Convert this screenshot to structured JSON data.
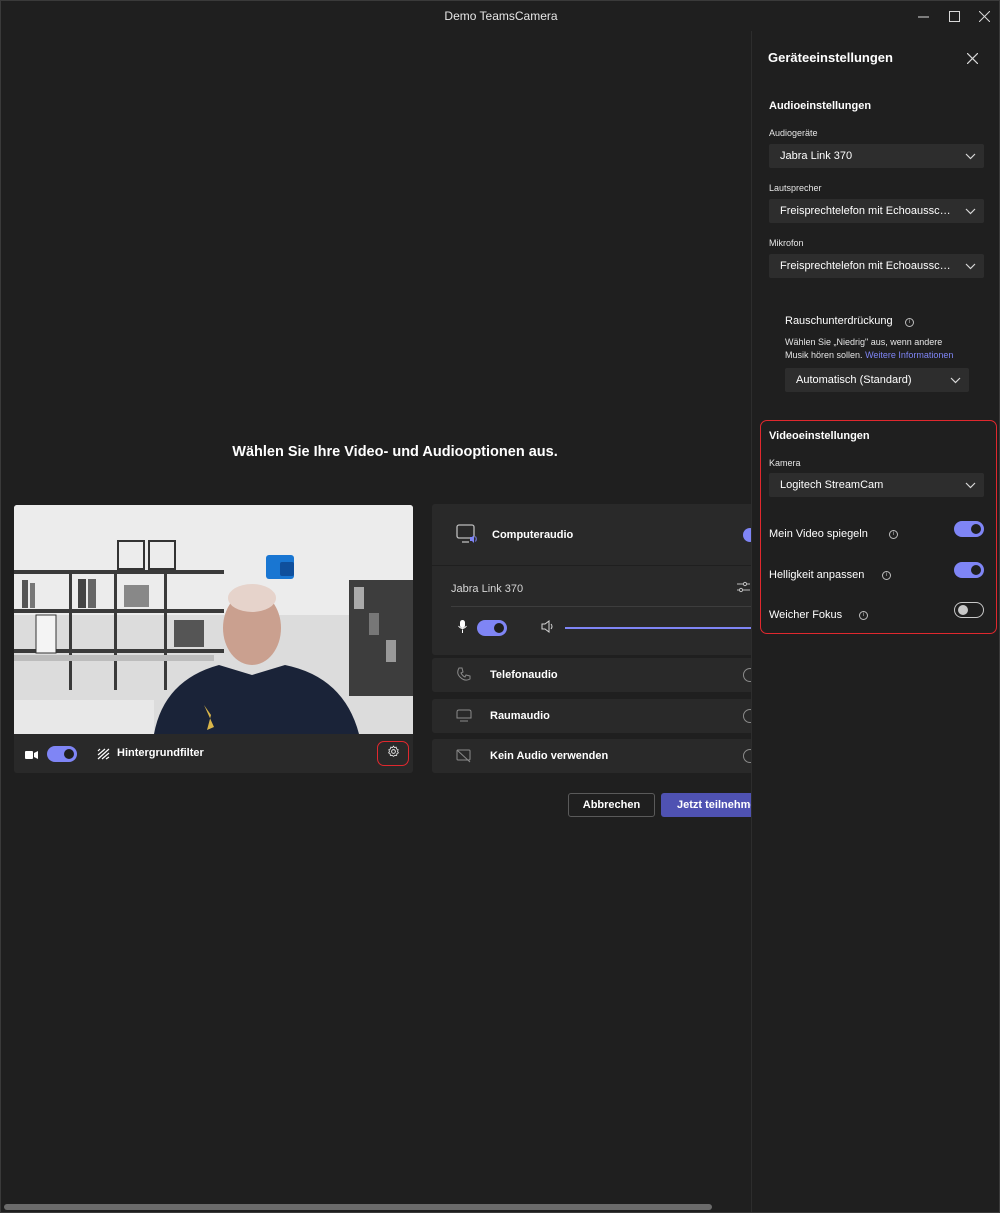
{
  "window": {
    "title": "Demo TeamsCamera"
  },
  "main": {
    "heading": "Wählen Sie Ihre Video- und Audiooptionen aus.",
    "video_bar": {
      "filter_label": "Hintergrundfilter"
    },
    "audio": {
      "computer_audio": "Computeraudio",
      "device": "Jabra Link 370",
      "phone_audio": "Telefonaudio",
      "room_audio": "Raumaudio",
      "no_audio": "Kein Audio verwenden"
    },
    "buttons": {
      "cancel": "Abbrechen",
      "join": "Jetzt teilnehmen"
    }
  },
  "panel": {
    "title": "Geräteeinstellungen",
    "audio_section": "Audioeinstellungen",
    "audio_devices_label": "Audiogeräte",
    "audio_devices_value": "Jabra Link 370",
    "speaker_label": "Lautsprecher",
    "speaker_value": "Freisprechtelefon mit Echoausschaltung",
    "mic_label": "Mikrofon",
    "mic_value": "Freisprechtelefon mit Echoausschaltung",
    "noise_title": "Rauschunterdrückung",
    "noise_desc_1": "Wählen Sie „Niedrig\" aus, wenn andere",
    "noise_desc_2": "Musik hören sollen.",
    "noise_link": "Weitere Informationen",
    "noise_value": "Automatisch (Standard)",
    "video_section": "Videoeinstellungen",
    "camera_label": "Kamera",
    "camera_value": "Logitech StreamCam",
    "mirror_label": "Mein Video spiegeln",
    "brightness_label": "Helligkeit anpassen",
    "soft_focus_label": "Weicher Fokus"
  },
  "colors": {
    "accent": "#7f85f5",
    "highlight": "#e0282e",
    "primary_button": "#4f52b2"
  }
}
